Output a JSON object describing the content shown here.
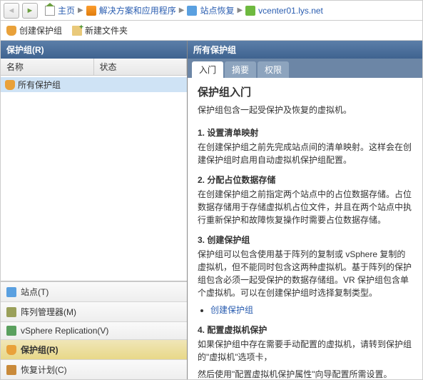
{
  "breadcrumb": {
    "home": "主页",
    "app": "解决方案和应用程序",
    "site": "站点恢复",
    "vc": "vcenter01.lys.net"
  },
  "toolbar": {
    "create_group": "创建保护组",
    "new_folder": "新建文件夹"
  },
  "left": {
    "header": "保护组(R)",
    "col_name": "名称",
    "col_status": "状态",
    "tree_item": "所有保护组"
  },
  "bottom_nav": {
    "site": "站点(T)",
    "array": "阵列管理器(M)",
    "vsr": "vSphere Replication(V)",
    "group": "保护组(R)",
    "plan": "恢复计划(C)"
  },
  "right": {
    "header": "所有保护组",
    "tabs": {
      "intro": "入门",
      "summary": "摘要",
      "perm": "权限"
    },
    "title": "保护组入门",
    "subtitle": "保护组包含一起受保护及恢复的虚拟机。",
    "s1_h": "1. 设置清单映射",
    "s1_p": "在创建保护组之前先完成站点间的清单映射。这样会在创建保护组时启用自动虚拟机保护组配置。",
    "s2_h": "2. 分配占位数据存储",
    "s2_p": "在创建保护组之前指定两个站点中的占位数据存储。占位数据存储用于存储虚拟机占位文件，并且在两个站点中执行重新保护和故障恢复操作时需要占位数据存储。",
    "s3_h": "3. 创建保护组",
    "s3_p": "保护组可以包含使用基于阵列的复制或 vSphere 复制的虚拟机，但不能同时包含这两种虚拟机。基于阵列的保护组包含必须一起受保护的数据存储组。VR 保护组包含单个虚拟机。可以在创建保护组时选择复制类型。",
    "s3_link": "创建保护组",
    "s4_h": "4. 配置虚拟机保护",
    "s4_p1": "如果保护组中存在需要手动配置的虚拟机，请转到保护组的\"虚拟机\"选项卡，",
    "s4_p2": "然后使用\"配置虚拟机保护属性\"向导配置所需设置。"
  }
}
